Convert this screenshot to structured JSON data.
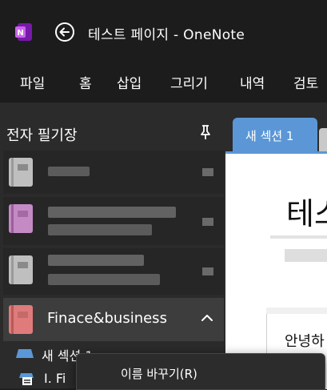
{
  "titlebar": {
    "title": "테스트 페이지  -  OneNote",
    "app_icon": "onenote-logo-icon",
    "back_icon": "back-arrow-icon"
  },
  "ribbon": {
    "tabs": [
      {
        "label": "파일"
      },
      {
        "label": "홈"
      },
      {
        "label": "삽입"
      },
      {
        "label": "그리기"
      },
      {
        "label": "내역"
      },
      {
        "label": "검토"
      }
    ]
  },
  "notebooks": {
    "header": "전자 필기장",
    "pin_icon": "pin-icon",
    "items": [
      {
        "name": "",
        "color": "#bfbfbf"
      },
      {
        "name": "",
        "color": "#c48ac4"
      },
      {
        "name": "",
        "color": "#bfbfbf"
      },
      {
        "name": "Finace&business",
        "color": "#e07b7b",
        "selected": true
      }
    ],
    "expand_icon": "chevron-up-icon"
  },
  "sections": [
    {
      "label": "새 섹션 1",
      "color": "#5b97d6"
    }
  ],
  "pages": [
    {
      "label": "I. Fi"
    }
  ],
  "section_tab": {
    "label": "새 섹션 1",
    "color": "#5b97d6"
  },
  "page": {
    "title": "테스",
    "body_text": "안녕하"
  },
  "context_menu": {
    "items": [
      {
        "label": "이름 바꾸기(R)"
      }
    ]
  }
}
